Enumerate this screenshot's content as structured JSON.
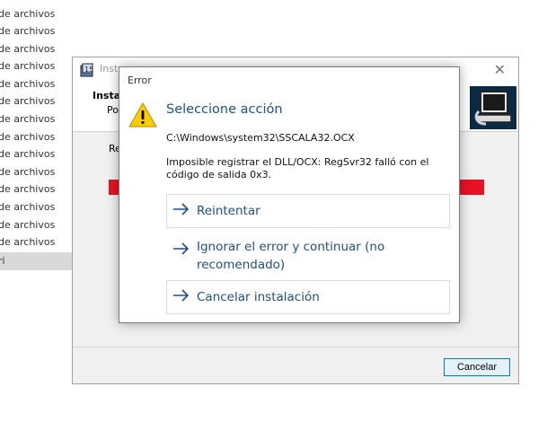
{
  "background_list": {
    "items": [
      "de archivos",
      "de archivos",
      "de archivos",
      "de archivos",
      "de archivos",
      "de archivos",
      "de archivos",
      "de archivos",
      "de archivos",
      "de archivos",
      "de archivos",
      "de archivos",
      "de archivos",
      "de archivos"
    ],
    "selected_item": "ri"
  },
  "installer": {
    "title": "Insta",
    "heading": "Insta",
    "subheading": "Po",
    "status": "Re",
    "progress": 1.0,
    "progress_color": "#e81123",
    "cancel_label": "Cancelar",
    "close_glyph": "✕"
  },
  "dialog": {
    "title": "Error",
    "icon": "warning-icon",
    "heading": "Seleccione acción",
    "path": "C:\\Windows\\system32\\SSCALA32.OCX",
    "message": "Imposible registrar el DLL/OCX: RegSvr32 falló con el código de salida 0x3.",
    "commands": {
      "retry": "Reintentar",
      "ignore": "Ignorar el error y continuar (no recomendado)",
      "cancel": "Cancelar instalación"
    },
    "accent_color": "#1e4f8c"
  }
}
